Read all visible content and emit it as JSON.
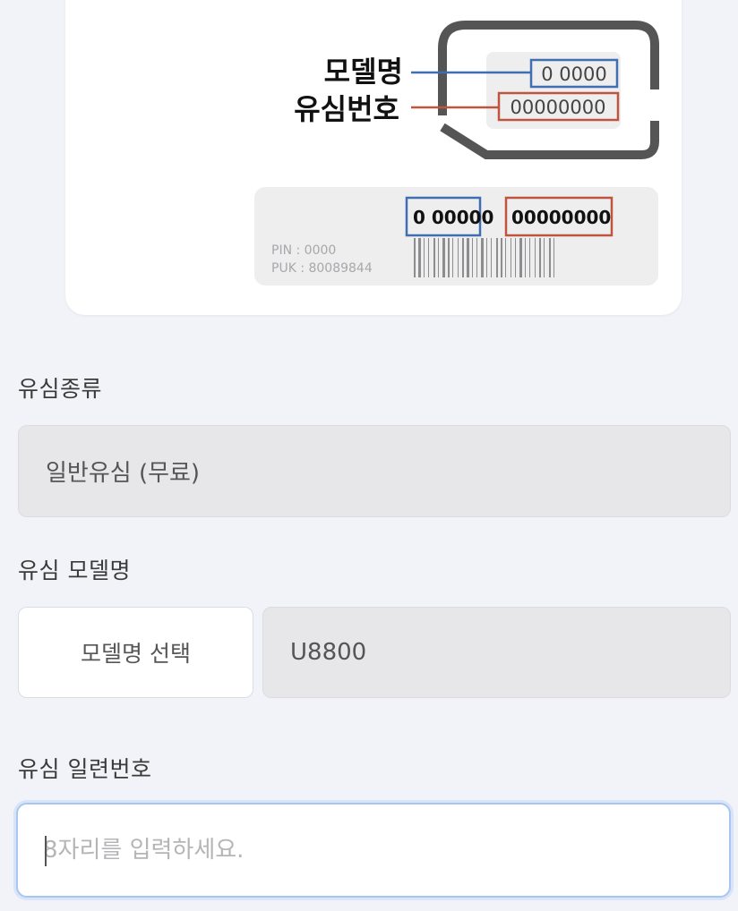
{
  "sim_guide": {
    "model_name_label": "모델명",
    "sim_number_label": "유심번호",
    "sim_model_code": "0 0000",
    "sim_serial_code": "00000000",
    "card_model_code": "0 00000",
    "card_serial_code": "00000000",
    "pin_text": "PIN  : 0000",
    "puk_text": "PUK : 80089844",
    "model_color": "#3f6fb0",
    "serial_color": "#c0553f"
  },
  "sim_type": {
    "label": "유심종류",
    "value": "일반유심 (무료)"
  },
  "sim_model": {
    "label": "유심 모델명",
    "select_button": "모델명 선택",
    "value": "U8800"
  },
  "sim_serial": {
    "label": "유심 일련번호",
    "placeholder": "8자리를 입력하세요."
  }
}
